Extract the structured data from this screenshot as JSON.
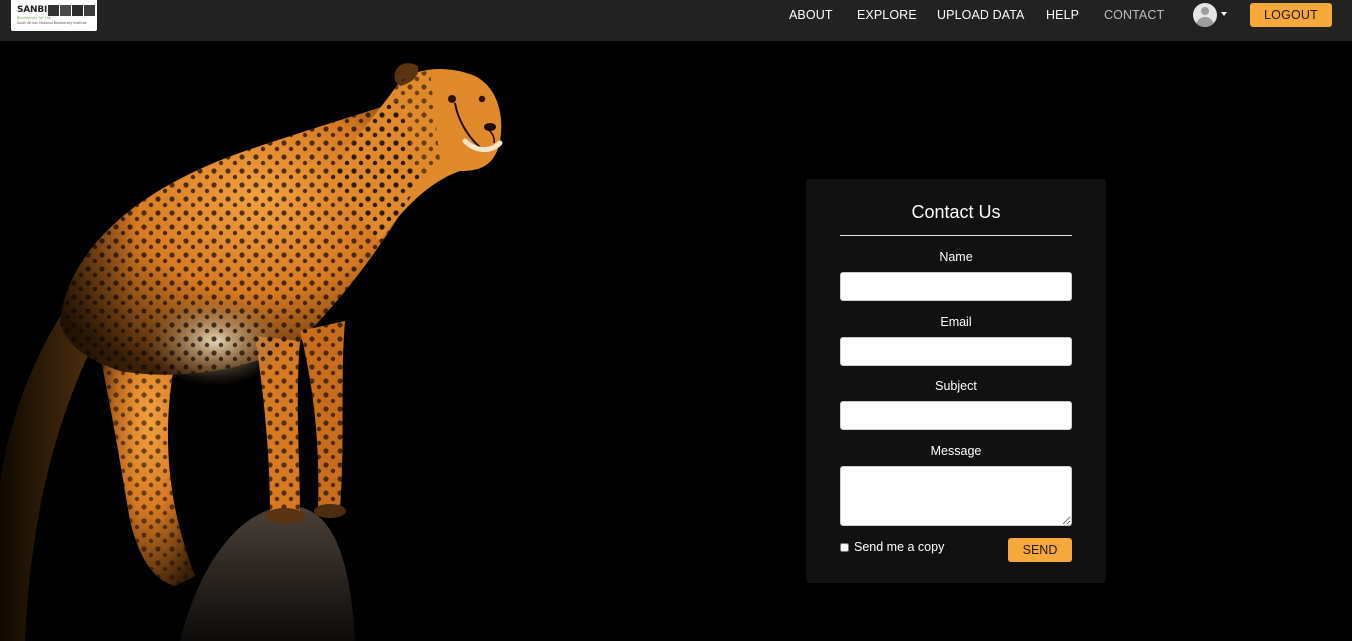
{
  "navbar": {
    "logo": {
      "name": "SANBI",
      "tagline": "Biodiversity for Life",
      "org": "South African National Biodiversity Institute"
    },
    "links": [
      {
        "label": "ABOUT"
      },
      {
        "label": "EXPLORE"
      },
      {
        "label": "UPLOAD DATA"
      },
      {
        "label": "HELP"
      },
      {
        "label": "CONTACT",
        "active": true
      }
    ],
    "user_icon": "user-avatar-icon",
    "logout_label": "LOGOUT"
  },
  "hero": {
    "subject": "cheetah-photo"
  },
  "contact": {
    "title": "Contact Us",
    "fields": {
      "name": {
        "label": "Name",
        "value": ""
      },
      "email": {
        "label": "Email",
        "value": ""
      },
      "subject": {
        "label": "Subject",
        "value": ""
      },
      "message": {
        "label": "Message",
        "value": ""
      }
    },
    "copy_label": "Send me a copy",
    "copy_checked": false,
    "send_label": "SEND"
  },
  "colors": {
    "accent": "#f7a83a",
    "navbar": "#222222",
    "card": "#111111",
    "background": "#000000"
  }
}
